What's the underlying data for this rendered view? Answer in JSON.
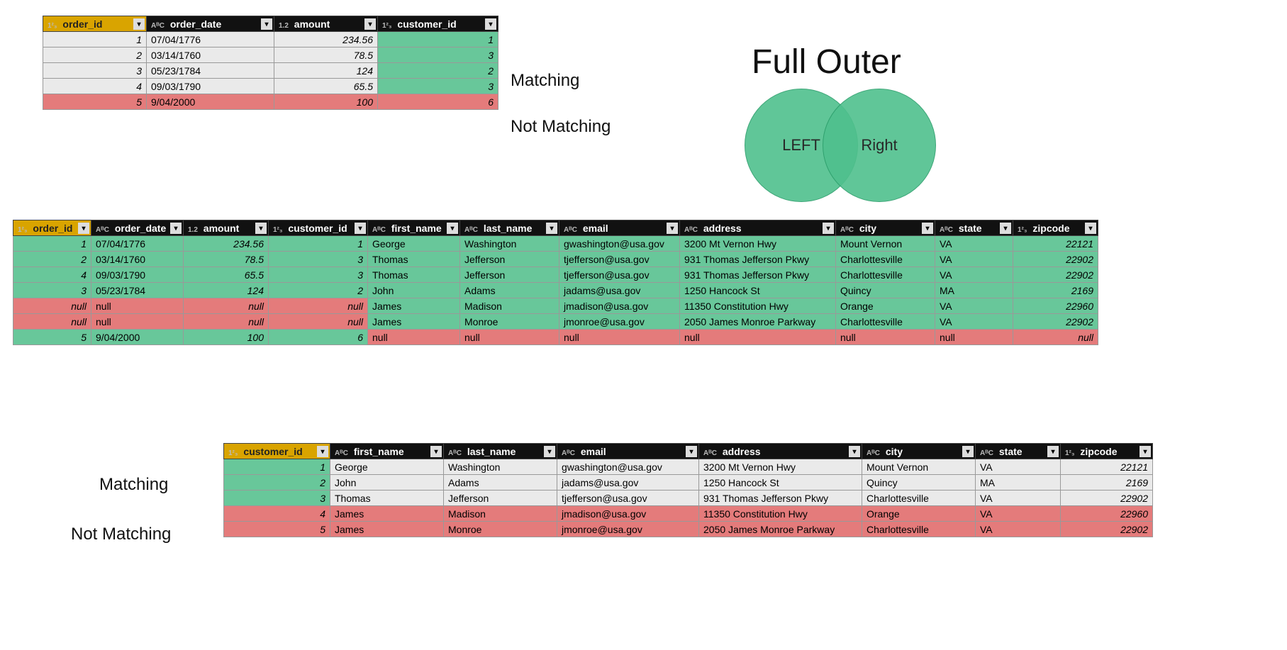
{
  "labels": {
    "matching": "Matching",
    "not_matching": "Not Matching",
    "title": "Full Outer",
    "left": "LEFT",
    "right": "Right"
  },
  "type_icons": {
    "num": "1²₃",
    "txt": "AᴮC",
    "dec": "1.2"
  },
  "orders": {
    "headers": [
      {
        "name": "order_id",
        "type": "num",
        "pk": true
      },
      {
        "name": "order_date",
        "type": "txt"
      },
      {
        "name": "amount",
        "type": "dec"
      },
      {
        "name": "customer_id",
        "type": "num"
      }
    ],
    "rows": [
      {
        "status": "match",
        "order_id": "1",
        "order_date": "07/04/1776",
        "amount": "234.56",
        "customer_id": "1"
      },
      {
        "status": "match",
        "order_id": "2",
        "order_date": "03/14/1760",
        "amount": "78.5",
        "customer_id": "3"
      },
      {
        "status": "match",
        "order_id": "3",
        "order_date": "05/23/1784",
        "amount": "124",
        "customer_id": "2"
      },
      {
        "status": "match",
        "order_id": "4",
        "order_date": "09/03/1790",
        "amount": "65.5",
        "customer_id": "3"
      },
      {
        "status": "nomatch",
        "order_id": "5",
        "order_date": "9/04/2000",
        "amount": "100",
        "customer_id": "6"
      }
    ]
  },
  "customers": {
    "headers": [
      {
        "name": "customer_id",
        "type": "num",
        "pk": true
      },
      {
        "name": "first_name",
        "type": "txt"
      },
      {
        "name": "last_name",
        "type": "txt"
      },
      {
        "name": "email",
        "type": "txt"
      },
      {
        "name": "address",
        "type": "txt"
      },
      {
        "name": "city",
        "type": "txt"
      },
      {
        "name": "state",
        "type": "txt"
      },
      {
        "name": "zipcode",
        "type": "num"
      }
    ],
    "rows": [
      {
        "status": "match",
        "customer_id": "1",
        "first_name": "George",
        "last_name": "Washington",
        "email": "gwashington@usa.gov",
        "address": "3200 Mt Vernon Hwy",
        "city": "Mount Vernon",
        "state": "VA",
        "zipcode": "22121"
      },
      {
        "status": "match",
        "customer_id": "2",
        "first_name": "John",
        "last_name": "Adams",
        "email": "jadams@usa.gov",
        "address": "1250 Hancock St",
        "city": "Quincy",
        "state": "MA",
        "zipcode": "2169"
      },
      {
        "status": "match",
        "customer_id": "3",
        "first_name": "Thomas",
        "last_name": "Jefferson",
        "email": "tjefferson@usa.gov",
        "address": "931 Thomas Jefferson Pkwy",
        "city": "Charlottesville",
        "state": "VA",
        "zipcode": "22902"
      },
      {
        "status": "nomatch",
        "customer_id": "4",
        "first_name": "James",
        "last_name": "Madison",
        "email": "jmadison@usa.gov",
        "address": "11350 Constitution Hwy",
        "city": "Orange",
        "state": "VA",
        "zipcode": "22960"
      },
      {
        "status": "nomatch",
        "customer_id": "5",
        "first_name": "James",
        "last_name": "Monroe",
        "email": "jmonroe@usa.gov",
        "address": "2050 James Monroe Parkway",
        "city": "Charlottesville",
        "state": "VA",
        "zipcode": "22902"
      }
    ]
  },
  "join": {
    "headers": [
      {
        "name": "order_id",
        "type": "num",
        "pk": true
      },
      {
        "name": "order_date",
        "type": "txt"
      },
      {
        "name": "amount",
        "type": "dec"
      },
      {
        "name": "customer_id",
        "type": "num"
      },
      {
        "name": "first_name",
        "type": "txt"
      },
      {
        "name": "last_name",
        "type": "txt"
      },
      {
        "name": "email",
        "type": "txt"
      },
      {
        "name": "address",
        "type": "txt"
      },
      {
        "name": "city",
        "type": "txt"
      },
      {
        "name": "state",
        "type": "txt"
      },
      {
        "name": "zipcode",
        "type": "num"
      }
    ],
    "rows": [
      {
        "left": "green",
        "right": "green",
        "order_id": "1",
        "order_date": "07/04/1776",
        "amount": "234.56",
        "customer_id": "1",
        "first_name": "George",
        "last_name": "Washington",
        "email": "gwashington@usa.gov",
        "address": "3200 Mt Vernon Hwy",
        "city": "Mount Vernon",
        "state": "VA",
        "zipcode": "22121"
      },
      {
        "left": "green",
        "right": "green",
        "order_id": "2",
        "order_date": "03/14/1760",
        "amount": "78.5",
        "customer_id": "3",
        "first_name": "Thomas",
        "last_name": "Jefferson",
        "email": "tjefferson@usa.gov",
        "address": "931 Thomas Jefferson Pkwy",
        "city": "Charlottesville",
        "state": "VA",
        "zipcode": "22902"
      },
      {
        "left": "green",
        "right": "green",
        "order_id": "4",
        "order_date": "09/03/1790",
        "amount": "65.5",
        "customer_id": "3",
        "first_name": "Thomas",
        "last_name": "Jefferson",
        "email": "tjefferson@usa.gov",
        "address": "931 Thomas Jefferson Pkwy",
        "city": "Charlottesville",
        "state": "VA",
        "zipcode": "22902"
      },
      {
        "left": "green",
        "right": "green",
        "order_id": "3",
        "order_date": "05/23/1784",
        "amount": "124",
        "customer_id": "2",
        "first_name": "John",
        "last_name": "Adams",
        "email": "jadams@usa.gov",
        "address": "1250 Hancock St",
        "city": "Quincy",
        "state": "MA",
        "zipcode": "2169"
      },
      {
        "left": "red",
        "right": "green",
        "order_id": "null",
        "order_date": "null",
        "amount": "null",
        "customer_id": "null",
        "first_name": "James",
        "last_name": "Madison",
        "email": "jmadison@usa.gov",
        "address": "11350 Constitution Hwy",
        "city": "Orange",
        "state": "VA",
        "zipcode": "22960"
      },
      {
        "left": "red",
        "right": "green",
        "order_id": "null",
        "order_date": "null",
        "amount": "null",
        "customer_id": "null",
        "first_name": "James",
        "last_name": "Monroe",
        "email": "jmonroe@usa.gov",
        "address": "2050 James Monroe Parkway",
        "city": "Charlottesville",
        "state": "VA",
        "zipcode": "22902"
      },
      {
        "left": "green",
        "right": "red",
        "order_id": "5",
        "order_date": "9/04/2000",
        "amount": "100",
        "customer_id": "6",
        "first_name": "null",
        "last_name": "null",
        "email": "null",
        "address": "null",
        "city": "null",
        "state": "null",
        "zipcode": "null"
      }
    ]
  },
  "col_widths": {
    "orders": [
      "146px",
      "180px",
      "146px",
      "170px"
    ],
    "join": [
      "110px",
      "130px",
      "120px",
      "140px",
      "130px",
      "140px",
      "170px",
      "220px",
      "140px",
      "110px",
      "120px"
    ],
    "customers": [
      "150px",
      "160px",
      "160px",
      "200px",
      "230px",
      "160px",
      "120px",
      "130px"
    ]
  }
}
